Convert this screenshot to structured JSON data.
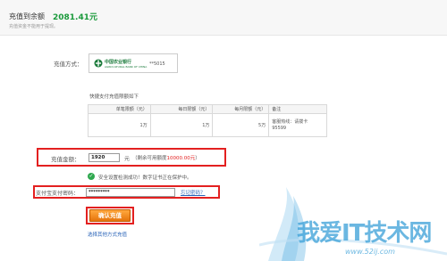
{
  "header": {
    "title": "充值到余额",
    "amount": "2081.41元",
    "hint": "充值资金不能用于提现。"
  },
  "method": {
    "label": "充值方式：",
    "bank_name": "中国农业银行",
    "bank_sub": "AGRICULTURAL BANK OF CHINA",
    "card_tail": "**5015"
  },
  "limits": {
    "title": "快捷支付充值限额如下",
    "headers": [
      "单笔限额（元）",
      "每日限额（元）",
      "每月限额（元）",
      "备注"
    ],
    "row": [
      "1万",
      "1万",
      "5万"
    ],
    "note_lines": [
      "客服热线：请拨卡",
      "95599"
    ]
  },
  "amount_field": {
    "label": "充值金额：",
    "value": "1920",
    "unit": "元",
    "hint_prefix": "（剩余可用额度",
    "hint_max": "10000.00元",
    "hint_suffix": "）"
  },
  "security": {
    "text": "安全设置检测成功！数字证书正在保护中。"
  },
  "password": {
    "label": "支付宝支付密码：",
    "value": "*********",
    "forgot": "忘记密码？"
  },
  "actions": {
    "submit": "确认充值",
    "other": "选择其他方式充值"
  },
  "watermark": {
    "text": "我爱IT技术网",
    "url": "www.52ij.com"
  },
  "colors": {
    "accent_green": "#1a9a3b",
    "highlight_red": "#e32020",
    "button_orange": "#e6740c",
    "link_blue": "#2a64b8"
  }
}
